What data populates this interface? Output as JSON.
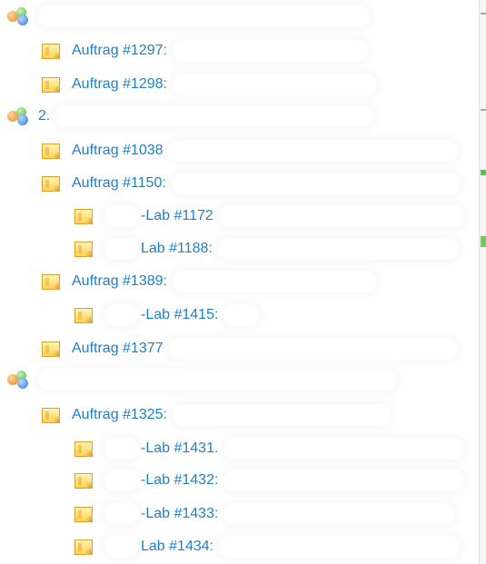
{
  "tree": {
    "groups": [
      {
        "label": "",
        "children": [
          {
            "label": "Auftrag #1297",
            "suffix": ":"
          },
          {
            "label": "Auftrag #1298",
            "suffix": ":"
          }
        ]
      },
      {
        "label": "2.",
        "children": [
          {
            "label": "Auftrag #1038",
            "suffix": "",
            "children": []
          },
          {
            "label": "Auftrag #1150",
            "suffix": ":",
            "children": [
              {
                "label": "-Lab #1172",
                "suffix": ""
              },
              {
                "label": "Lab #1188",
                "suffix": ":"
              }
            ]
          },
          {
            "label": "Auftrag #1389",
            "suffix": ":",
            "children": [
              {
                "label": "-Lab #1415",
                "suffix": ":"
              }
            ]
          },
          {
            "label": "Auftrag #1377",
            "suffix": "",
            "children": []
          }
        ]
      },
      {
        "label": "",
        "children": [
          {
            "label": "Auftrag #1325",
            "suffix": ":",
            "children": [
              {
                "label": "-Lab #1431",
                "suffix": "."
              },
              {
                "label": "-Lab #1432",
                "suffix": ":"
              },
              {
                "label": "-Lab #1433",
                "suffix": ":"
              },
              {
                "label": "Lab #1434",
                "suffix": ":"
              }
            ]
          }
        ]
      }
    ]
  },
  "colors": {
    "link": "#1f7fc6",
    "scrollbar_track": "#f7f7f7",
    "scroll_marker_gray": "#a9a9a9",
    "scroll_marker_green": "#57c14b"
  }
}
